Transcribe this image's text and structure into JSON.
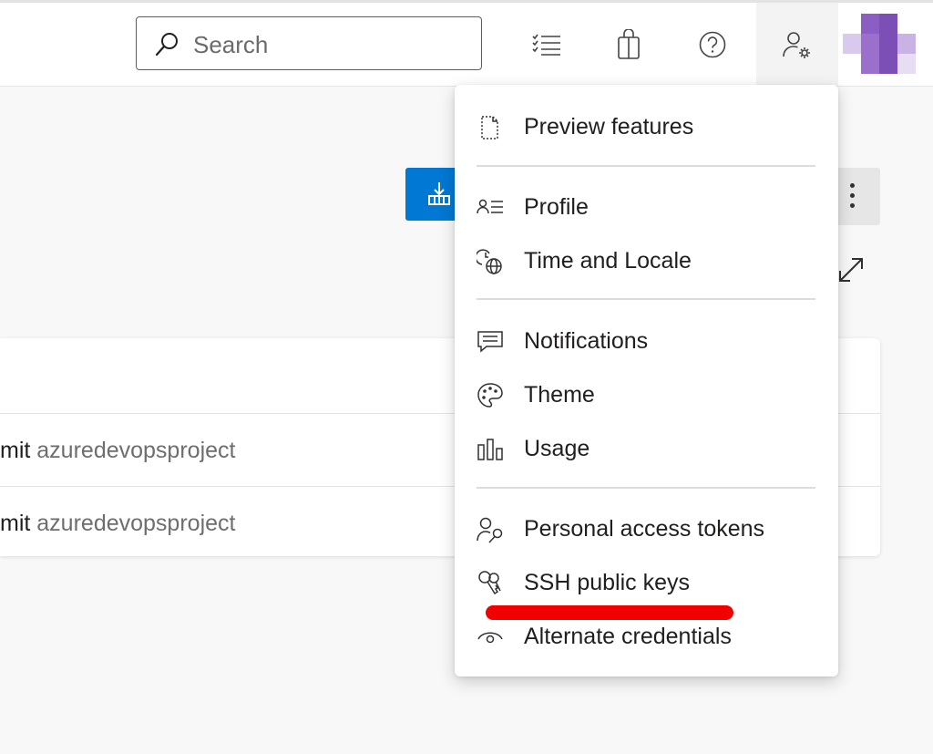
{
  "header": {
    "search": {
      "placeholder": "Search"
    },
    "icons": [
      "work-items-icon",
      "marketplace-icon",
      "help-icon",
      "user-settings-icon"
    ]
  },
  "background": {
    "rows": [
      {
        "prefix": "mit",
        "project": "azuredevopsproject"
      },
      {
        "prefix": "mit",
        "project": "azuredevopsproject"
      }
    ]
  },
  "menu": {
    "groups": [
      [
        {
          "label": "Preview features",
          "icon": "preview-features-icon"
        }
      ],
      [
        {
          "label": "Profile",
          "icon": "profile-icon"
        },
        {
          "label": "Time and Locale",
          "icon": "time-locale-icon"
        }
      ],
      [
        {
          "label": "Notifications",
          "icon": "notifications-icon"
        },
        {
          "label": "Theme",
          "icon": "theme-icon"
        },
        {
          "label": "Usage",
          "icon": "usage-icon"
        }
      ],
      [
        {
          "label": "Personal access tokens",
          "icon": "personal-access-tokens-icon"
        },
        {
          "label": "SSH public keys",
          "icon": "ssh-keys-icon"
        },
        {
          "label": "Alternate credentials",
          "icon": "alternate-credentials-icon"
        }
      ]
    ]
  },
  "colors": {
    "accent": "#0078d4",
    "highlight": "#f20000",
    "avatar": [
      "#7b4fb5",
      "#9a70cc",
      "#c9b3e3",
      "#e8def3"
    ]
  }
}
